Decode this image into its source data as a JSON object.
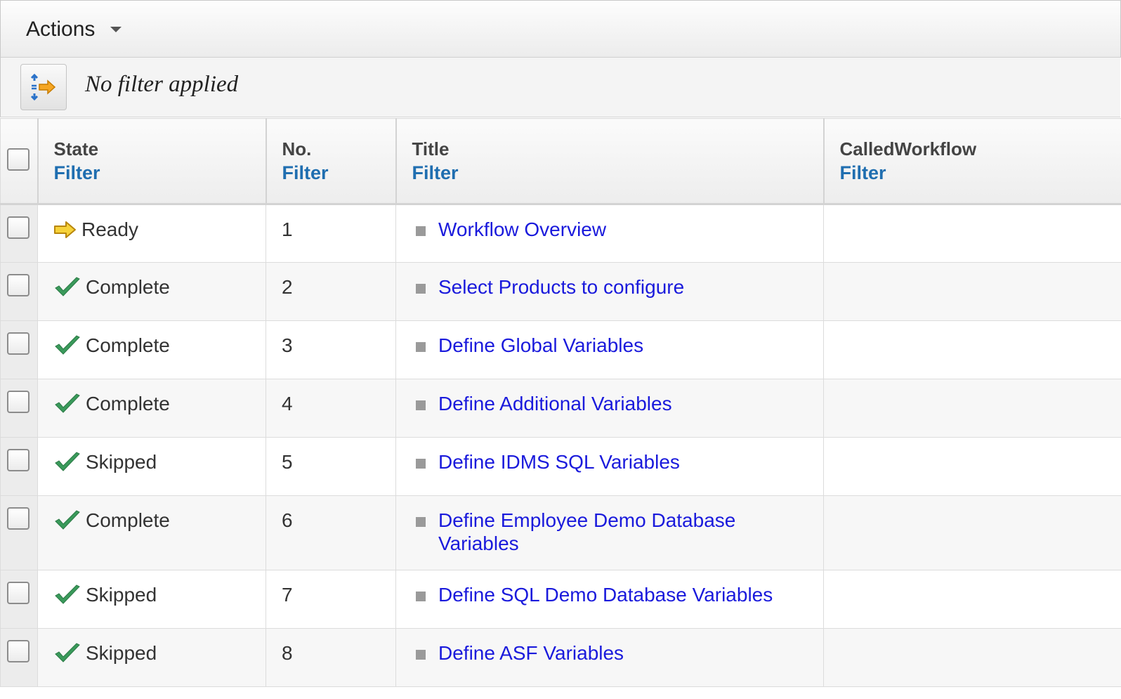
{
  "toolbar": {
    "actions_label": "Actions"
  },
  "filter_bar": {
    "status": "No filter applied"
  },
  "columns": {
    "state": {
      "label": "State",
      "filter": "Filter"
    },
    "no": {
      "label": "No.",
      "filter": "Filter"
    },
    "title": {
      "label": "Title",
      "filter": "Filter"
    },
    "called": {
      "label": "CalledWorkflow",
      "filter": "Filter"
    }
  },
  "rows": [
    {
      "state": "Ready",
      "state_icon": "ready-arrow-icon",
      "no": "1",
      "title": "Workflow Overview",
      "called": ""
    },
    {
      "state": "Complete",
      "state_icon": "checkmark-icon",
      "no": "2",
      "title": "Select Products to configure",
      "called": ""
    },
    {
      "state": "Complete",
      "state_icon": "checkmark-icon",
      "no": "3",
      "title": "Define Global Variables",
      "called": ""
    },
    {
      "state": "Complete",
      "state_icon": "checkmark-icon",
      "no": "4",
      "title": "Define Additional Variables",
      "called": ""
    },
    {
      "state": "Skipped",
      "state_icon": "checkmark-icon",
      "no": "5",
      "title": "Define IDMS SQL Variables",
      "called": ""
    },
    {
      "state": "Complete",
      "state_icon": "checkmark-icon",
      "no": "6",
      "title": "Define Employee Demo Database Variables",
      "called": ""
    },
    {
      "state": "Skipped",
      "state_icon": "checkmark-icon",
      "no": "7",
      "title": "Define SQL Demo Database Variables",
      "called": ""
    },
    {
      "state": "Skipped",
      "state_icon": "checkmark-icon",
      "no": "8",
      "title": "Define ASF Variables",
      "called": ""
    }
  ],
  "colors": {
    "link": "#1a1adc",
    "filter_link": "#1f6eb0",
    "check": "#3a9a5b",
    "arrow": "#f2c200"
  }
}
